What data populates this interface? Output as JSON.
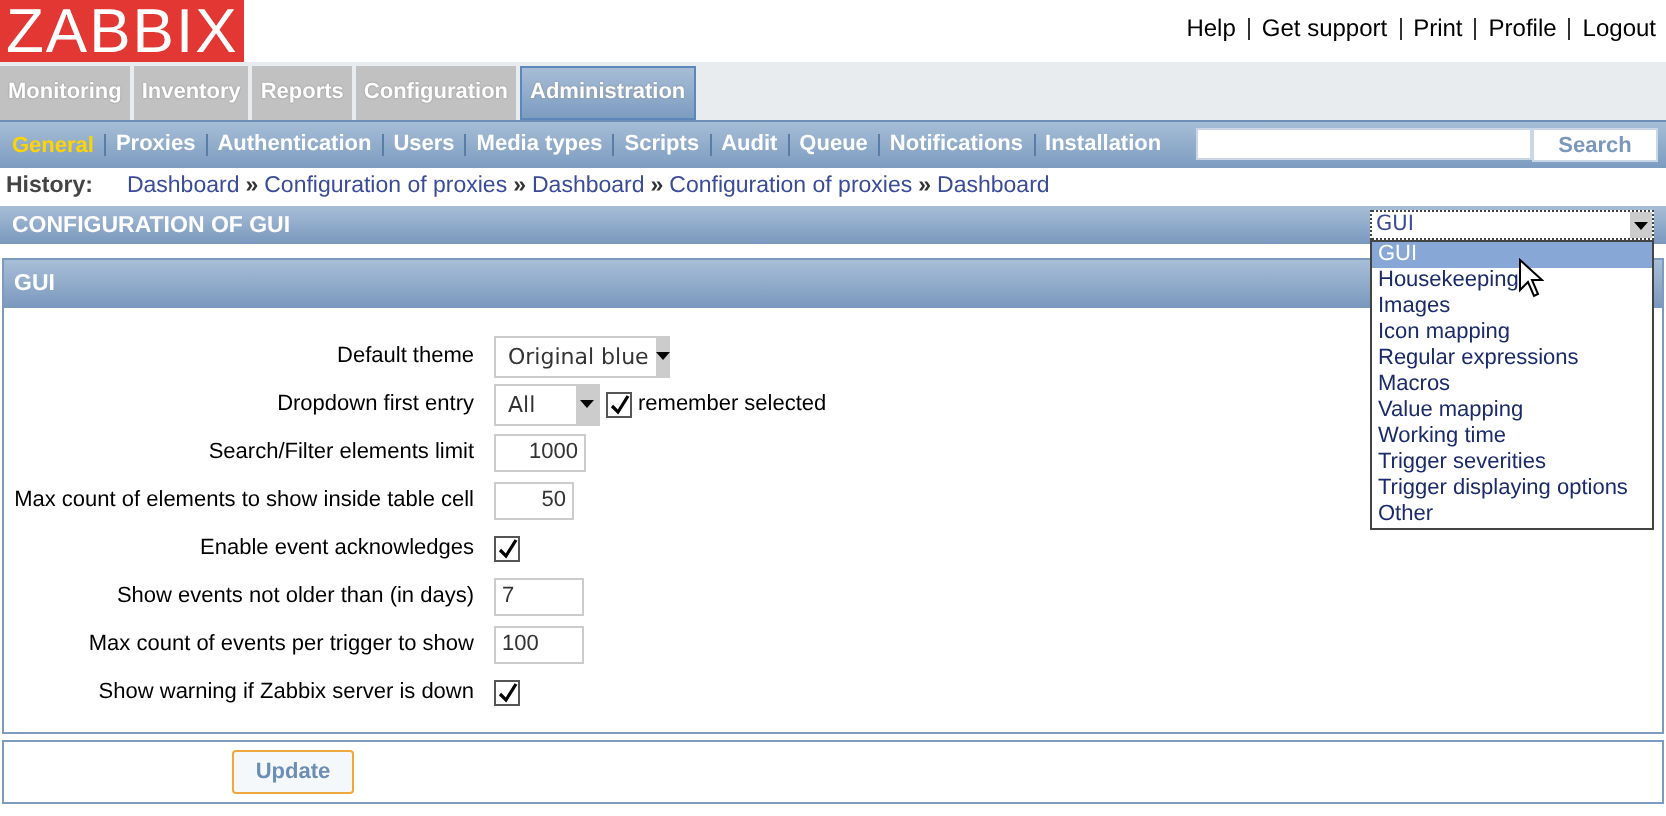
{
  "logo": "ZABBIX",
  "header_links": [
    "Help",
    "Get support",
    "Print",
    "Profile",
    "Logout"
  ],
  "main_tabs": [
    {
      "label": "Monitoring",
      "selected": false
    },
    {
      "label": "Inventory",
      "selected": false
    },
    {
      "label": "Reports",
      "selected": false
    },
    {
      "label": "Configuration",
      "selected": false
    },
    {
      "label": "Administration",
      "selected": true
    }
  ],
  "sub_tabs": [
    {
      "label": "General",
      "selected": true
    },
    {
      "label": "Proxies",
      "selected": false
    },
    {
      "label": "Authentication",
      "selected": false
    },
    {
      "label": "Users",
      "selected": false
    },
    {
      "label": "Media types",
      "selected": false
    },
    {
      "label": "Scripts",
      "selected": false
    },
    {
      "label": "Audit",
      "selected": false
    },
    {
      "label": "Queue",
      "selected": false
    },
    {
      "label": "Notifications",
      "selected": false
    },
    {
      "label": "Installation",
      "selected": false
    }
  ],
  "search": {
    "button": "Search"
  },
  "history": {
    "label": "History:",
    "separator": "»",
    "items": [
      "Dashboard",
      "Configuration of proxies",
      "Dashboard",
      "Configuration of proxies",
      "Dashboard"
    ]
  },
  "page_title": "CONFIGURATION OF GUI",
  "section_select": {
    "value": "GUI",
    "options": [
      {
        "label": "GUI",
        "selected": true
      },
      {
        "label": "Housekeeping",
        "selected": false
      },
      {
        "label": "Images",
        "selected": false
      },
      {
        "label": "Icon mapping",
        "selected": false
      },
      {
        "label": "Regular expressions",
        "selected": false
      },
      {
        "label": "Macros",
        "selected": false
      },
      {
        "label": "Value mapping",
        "selected": false
      },
      {
        "label": "Working time",
        "selected": false
      },
      {
        "label": "Trigger severities",
        "selected": false
      },
      {
        "label": "Trigger displaying options",
        "selected": false
      },
      {
        "label": "Other",
        "selected": false
      }
    ]
  },
  "panel_title": "GUI",
  "fields": [
    {
      "kind": "select",
      "label": "Default theme",
      "value": "Original blue"
    },
    {
      "kind": "select",
      "label": "Dropdown first entry",
      "value": "All",
      "checkbox": {
        "label": "remember selected",
        "checked": true
      }
    },
    {
      "kind": "number",
      "label": "Search/Filter elements limit",
      "value": "1000"
    },
    {
      "kind": "number",
      "label": "Max count of elements to show inside table cell",
      "value": "50"
    },
    {
      "kind": "checkbox",
      "label": "Enable event acknowledges",
      "checked": true
    },
    {
      "kind": "text",
      "label": "Show events not older than (in days)",
      "value": "7"
    },
    {
      "kind": "text",
      "label": "Max count of events per trigger to show",
      "value": "100"
    },
    {
      "kind": "checkbox",
      "label": "Show warning if Zabbix server is down",
      "checked": true
    }
  ],
  "update_button": "Update"
}
